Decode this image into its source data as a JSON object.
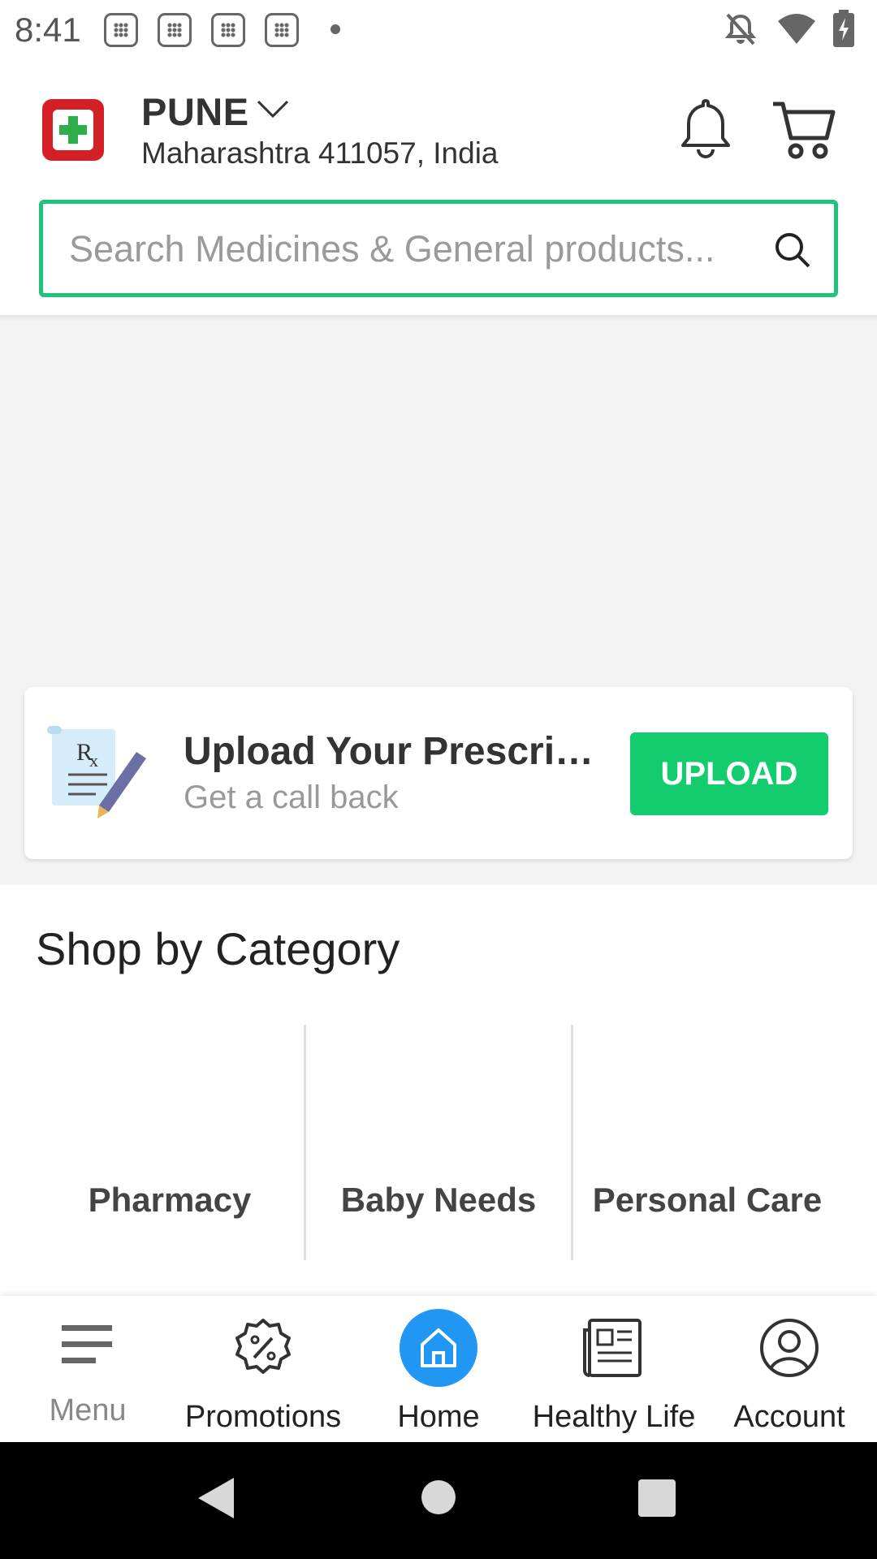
{
  "status_bar": {
    "time": "8:41"
  },
  "header": {
    "city": "PUNE",
    "address": "Maharashtra 411057, India"
  },
  "search": {
    "placeholder": "Search Medicines & General products..."
  },
  "prescription": {
    "title": "Upload Your Prescript…",
    "subtitle": "Get a call back",
    "button_label": "UPLOAD"
  },
  "categories": {
    "title": "Shop by Category",
    "items": [
      {
        "label": "Pharmacy"
      },
      {
        "label": "Baby Needs"
      },
      {
        "label": "Personal Care"
      }
    ]
  },
  "bottom_nav": {
    "items": [
      {
        "label": "Menu",
        "icon": "menu-icon"
      },
      {
        "label": "Promotions",
        "icon": "promotions-icon"
      },
      {
        "label": "Home",
        "icon": "home-icon",
        "active": true
      },
      {
        "label": "Healthy Life",
        "icon": "newspaper-icon"
      },
      {
        "label": "Account",
        "icon": "account-icon"
      }
    ]
  },
  "colors": {
    "accent_green": "#12cc6e",
    "search_border": "#1fc47c",
    "logo_red": "#d32027",
    "home_active": "#2196f3"
  }
}
